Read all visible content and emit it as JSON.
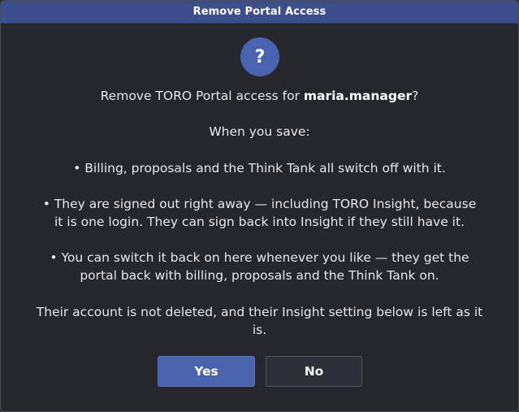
{
  "dialog": {
    "title": "Remove Portal Access",
    "icon": "question-icon",
    "icon_glyph": "?",
    "prompt_prefix": "Remove TORO Portal access for ",
    "prompt_user": "maria.manager",
    "prompt_suffix": "?",
    "when_save": "When you save:",
    "bullet1": "• Billing, proposals and the Think Tank all switch off with it.",
    "bullet2_line1": "• They are signed out right away — including TORO Insight, because",
    "bullet2_line2": "it is one login. They can sign back into Insight if they still have it.",
    "bullet3_line1": "• You can switch it back on here whenever you like — they get the",
    "bullet3_line2": "portal back with billing, proposals and the Think Tank on.",
    "footer_line1": "Their account is not deleted, and their Insight setting below is left as it",
    "footer_line2": "is.",
    "yes_label": "Yes",
    "no_label": "No"
  },
  "colors": {
    "titlebar": "#3c4f8c",
    "background": "#25272d",
    "accent": "#4a63ad"
  }
}
